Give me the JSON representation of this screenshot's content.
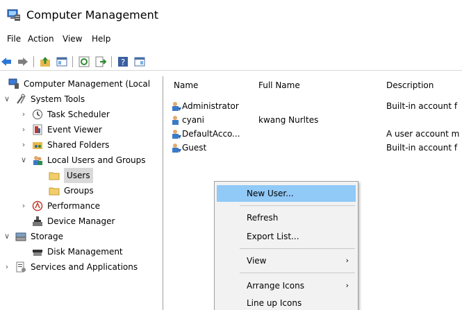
{
  "window": {
    "title": "Computer Management"
  },
  "menu": [
    "File",
    "Action",
    "View",
    "Help"
  ],
  "tree": {
    "root": "Computer Management (Local",
    "system_tools": "System Tools",
    "task_scheduler": "Task Scheduler",
    "event_viewer": "Event Viewer",
    "shared_folders": "Shared Folders",
    "local_users_groups": "Local Users and Groups",
    "users": "Users",
    "groups": "Groups",
    "performance": "Performance",
    "device_manager": "Device Manager",
    "storage": "Storage",
    "disk_management": "Disk Management",
    "services_apps": "Services and Applications"
  },
  "list": {
    "columns": [
      "Name",
      "Full Name",
      "Description"
    ],
    "rows": [
      {
        "name": "Administrator",
        "full_name": "",
        "description": "Built-in account f"
      },
      {
        "name": "cyani",
        "full_name": "kwang Nurltes",
        "description": ""
      },
      {
        "name": "DefaultAcco...",
        "full_name": "",
        "description": "A user account m"
      },
      {
        "name": "Guest",
        "full_name": "",
        "description": "Built-in account f"
      }
    ]
  },
  "context_menu": {
    "new_user": "New User...",
    "refresh": "Refresh",
    "export_list": "Export List...",
    "view": "View",
    "arrange_icons": "Arrange Icons",
    "line_up_icons": "Line up Icons",
    "submenu_arrow": "›"
  },
  "icons": {
    "expanded": "∨",
    "collapsed": "›"
  },
  "colors": {
    "highlight": "#91c9f7",
    "selected_node": "#d9d9d9",
    "menu_bg": "#f2f2f2"
  }
}
